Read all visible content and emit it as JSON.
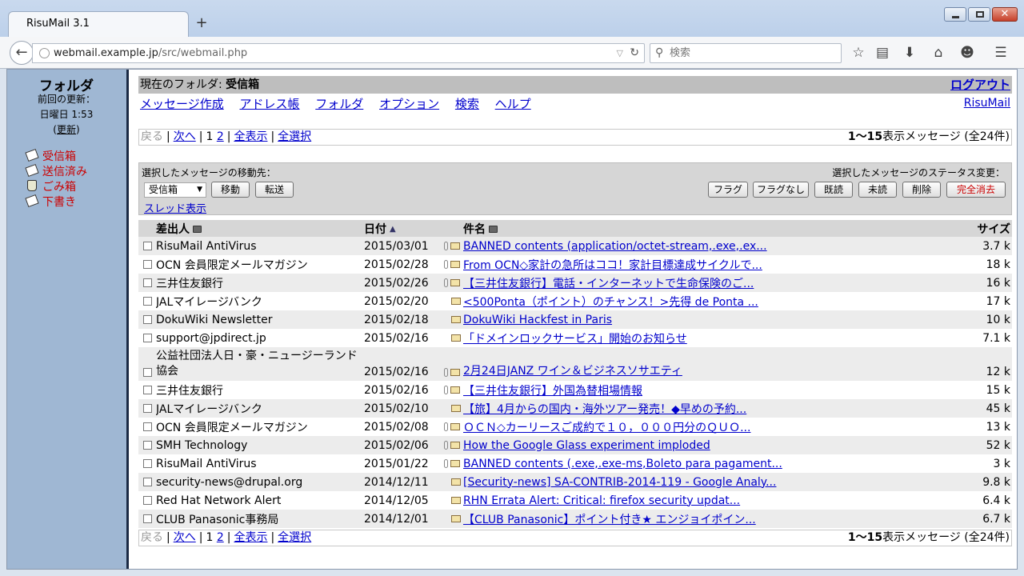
{
  "browser": {
    "tab_title": "RisuMail 3.1",
    "new_tab": "+",
    "url_host": "webmail.example.jp",
    "url_path": "/src/webmail.php",
    "search_placeholder": "検索"
  },
  "sidebar": {
    "title": "フォルダ",
    "last_update_label": "前回の更新：",
    "last_update_time": "日曜日 1:53",
    "refresh_open": "(",
    "refresh_label": "更新",
    "refresh_close": ")",
    "folders": [
      {
        "label": "受信箱",
        "icon": "inbox-icon"
      },
      {
        "label": "送信済み",
        "icon": "sent-icon"
      },
      {
        "label": "ごみ箱",
        "icon": "trash-icon"
      },
      {
        "label": "下書き",
        "icon": "drafts-icon"
      }
    ]
  },
  "header": {
    "current_folder_label": "現在のフォルダ:",
    "current_folder": "受信箱",
    "logout": "ログアウト",
    "brand": "RisuMail",
    "menu": [
      "メッセージ作成",
      "アドレス帳",
      "フォルダ",
      "オプション",
      "検索",
      "ヘルプ"
    ]
  },
  "pager": {
    "prev": "戻る",
    "next": "次へ",
    "page_current": "1",
    "page_other": "2",
    "show_all": "全表示",
    "select_all": "全選択",
    "range": "1〜15",
    "count_text": "表示メッセージ (全24件)"
  },
  "actions": {
    "move_label": "選択したメッセージの移動先：",
    "move_target": "受信箱",
    "move_button": "移動",
    "forward_button": "転送",
    "thread_view": "スレッド表示",
    "status_label": "選択したメッセージのステータス変更：",
    "status_buttons": [
      "フラグ",
      "フラグなし",
      "既読",
      "未読",
      "削除",
      "完全消去"
    ]
  },
  "columns": {
    "from": "差出人",
    "date": "日付",
    "subject": "件名",
    "size": "サイズ"
  },
  "messages": [
    {
      "from": "RisuMail AntiVirus",
      "date": "2015/03/01",
      "attach": true,
      "subject": "BANNED contents (application/octet-stream,.exe,.ex...",
      "size": "3.7 k"
    },
    {
      "from": "OCN 会員限定メールマガジン",
      "date": "2015/02/28",
      "attach": true,
      "subject": "From OCN◇家計の急所はココ！家計目標達成サイクルで...",
      "size": "18 k"
    },
    {
      "from": "三井住友銀行",
      "date": "2015/02/26",
      "attach": true,
      "subject": "【三井住友銀行】電話・インターネットで生命保険のご...",
      "size": "16 k"
    },
    {
      "from": "JALマイレージバンク",
      "date": "2015/02/20",
      "attach": false,
      "subject": "<500Ponta（ポイント）のチャンス！>先得 de Ponta ...",
      "size": "17 k"
    },
    {
      "from": "DokuWiki Newsletter",
      "date": "2015/02/18",
      "attach": false,
      "subject": "DokuWiki Hackfest in Paris",
      "size": "10 k"
    },
    {
      "from": "support@jpdirect.jp",
      "date": "2015/02/16",
      "attach": false,
      "subject": "「ドメインロックサービス」開始のお知らせ",
      "size": "7.1 k"
    },
    {
      "from": "公益社団法人日・豪・ニュージーランド協会",
      "date": "2015/02/16",
      "attach": true,
      "subject": "2月24日JANZ ワイン＆ビジネスソサエティ",
      "size": "12 k",
      "tall": true
    },
    {
      "from": "三井住友銀行",
      "date": "2015/02/16",
      "attach": true,
      "subject": "【三井住友銀行】外国為替相場情報",
      "size": "15 k"
    },
    {
      "from": "JALマイレージバンク",
      "date": "2015/02/10",
      "attach": false,
      "subject": "【旅】4月からの国内・海外ツアー発売！◆早めの予約...",
      "size": "45 k"
    },
    {
      "from": "OCN 会員限定メールマガジン",
      "date": "2015/02/08",
      "attach": true,
      "subject": "ＯＣＮ◇カーリースご成約で１０，０００円分のＱＵＯ...",
      "size": "13 k"
    },
    {
      "from": "SMH Technology",
      "date": "2015/02/06",
      "attach": true,
      "subject": "How the Google Glass experiment imploded",
      "size": "52 k"
    },
    {
      "from": "RisuMail AntiVirus",
      "date": "2015/01/22",
      "attach": true,
      "subject": "BANNED contents (.exe,.exe-ms,Boleto para pagament...",
      "size": "3 k"
    },
    {
      "from": "security-news@drupal.org",
      "date": "2014/12/11",
      "attach": false,
      "subject": "[Security-news] SA-CONTRIB-2014-119 - Google Analy...",
      "size": "9.8 k"
    },
    {
      "from": "Red Hat Network Alert",
      "date": "2014/12/05",
      "attach": false,
      "subject": "RHN Errata Alert: Critical: firefox security updat...",
      "size": "6.4 k"
    },
    {
      "from": "CLUB Panasonic事務局",
      "date": "2014/12/01",
      "attach": false,
      "subject": "【CLUB Panasonic】ポイント付き★ エンジョイポイン...",
      "size": "6.7 k"
    }
  ]
}
